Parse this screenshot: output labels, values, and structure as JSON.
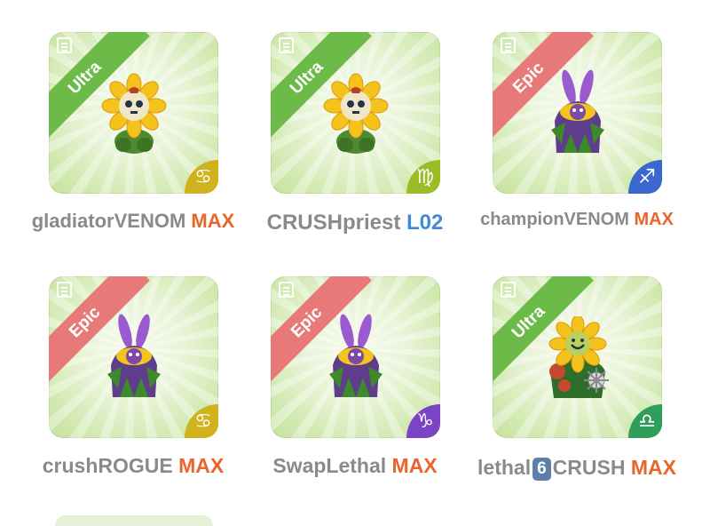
{
  "colors": {
    "ultra_ribbon": "#6cbb49",
    "epic_ribbon": "#e77a78",
    "max_level": "#e8662b",
    "low_level": "#3f8ad8",
    "name_text": "#8a8a8a"
  },
  "monsters": [
    {
      "rarity": "Ultra",
      "name_part1": "gladiatorVENOM",
      "level": "MAX",
      "zodiac_symbol": "♋",
      "zodiac_icon": "cancer-icon",
      "zodiac_color": "#d0b21e",
      "monster": "sunflower-skull"
    },
    {
      "rarity": "Ultra",
      "name_part1": "CRUSHpriest",
      "level": "L02",
      "zodiac_symbol": "♍",
      "zodiac_icon": "virgo-icon",
      "zodiac_color": "#9cbc27",
      "monster": "sunflower-skull"
    },
    {
      "rarity": "Epic",
      "name_part1": "championVENOM",
      "level": "MAX",
      "zodiac_symbol": "♐",
      "zodiac_icon": "sagittarius-icon",
      "zodiac_color": "#3b67d0",
      "monster": "purple-bunny-plant"
    },
    {
      "rarity": "Epic",
      "name_part1": "crushROGUE",
      "level": "MAX",
      "zodiac_symbol": "♋",
      "zodiac_icon": "cancer-icon",
      "zodiac_color": "#d0b21e",
      "monster": "purple-bunny-plant"
    },
    {
      "rarity": "Epic",
      "name_part1": "SwapLethal",
      "level": "MAX",
      "zodiac_symbol": "♑",
      "zodiac_icon": "capricorn-icon",
      "zodiac_color": "#7b44c4",
      "monster": "purple-bunny-plant"
    },
    {
      "rarity": "Ultra",
      "name_part1": "lethal",
      "badge": "6",
      "name_part2": "CRUSH",
      "level": "MAX",
      "zodiac_symbol": "♎",
      "zodiac_icon": "libra-icon",
      "zodiac_color": "#2f9e5b",
      "monster": "sunflower-mace"
    }
  ]
}
